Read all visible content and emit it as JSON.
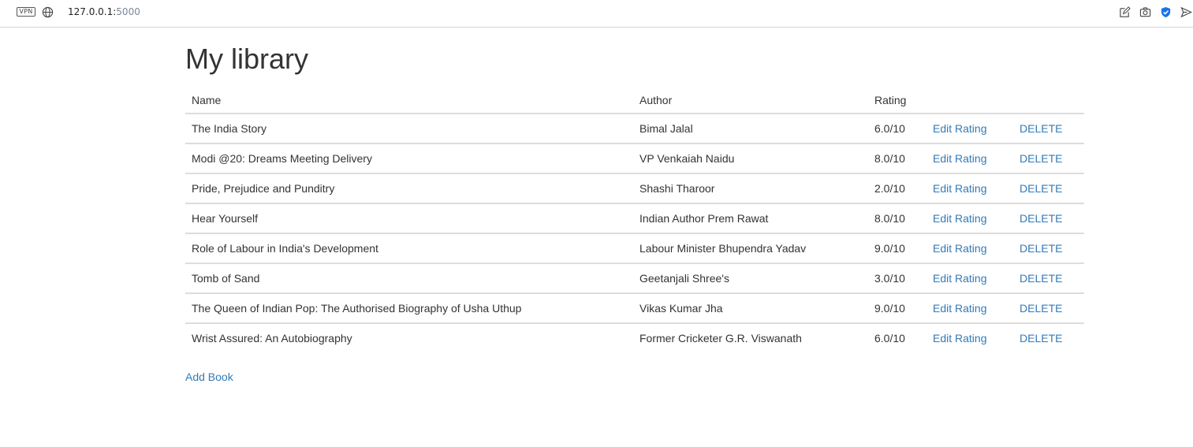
{
  "browser": {
    "vpn_label": "VPN",
    "url_host": "127.0.0.1:",
    "url_port": "5000"
  },
  "page": {
    "title": "My library",
    "add_book_label": "Add Book"
  },
  "table": {
    "headers": {
      "name": "Name",
      "author": "Author",
      "rating": "Rating"
    },
    "edit_label": "Edit Rating",
    "delete_label": "DELETE",
    "rows": [
      {
        "name": "The India Story",
        "author": "Bimal Jalal",
        "rating": "6.0/10"
      },
      {
        "name": "Modi @20: Dreams Meeting Delivery",
        "author": "VP Venkaiah Naidu",
        "rating": "8.0/10"
      },
      {
        "name": "Pride, Prejudice and Punditry",
        "author": "Shashi Tharoor",
        "rating": "2.0/10"
      },
      {
        "name": "Hear Yourself",
        "author": "Indian Author Prem Rawat",
        "rating": "8.0/10"
      },
      {
        "name": "Role of Labour in India's Development",
        "author": "Labour Minister Bhupendra Yadav",
        "rating": "9.0/10"
      },
      {
        "name": "Tomb of Sand",
        "author": "Geetanjali Shree's",
        "rating": "3.0/10"
      },
      {
        "name": "The Queen of Indian Pop: The Authorised Biography of Usha Uthup",
        "author": "Vikas Kumar Jha",
        "rating": "9.0/10"
      },
      {
        "name": "Wrist Assured: An Autobiography",
        "author": "Former Cricketer G.R. Viswanath",
        "rating": "6.0/10"
      }
    ]
  },
  "colors": {
    "link": "#337ab7",
    "text": "#333333",
    "row_border": "#dddddd",
    "shield_accent": "#1a73e8"
  },
  "icons": [
    "vpn-badge",
    "globe-icon",
    "edit-page-icon",
    "camera-icon",
    "shield-check-icon",
    "send-icon"
  ]
}
